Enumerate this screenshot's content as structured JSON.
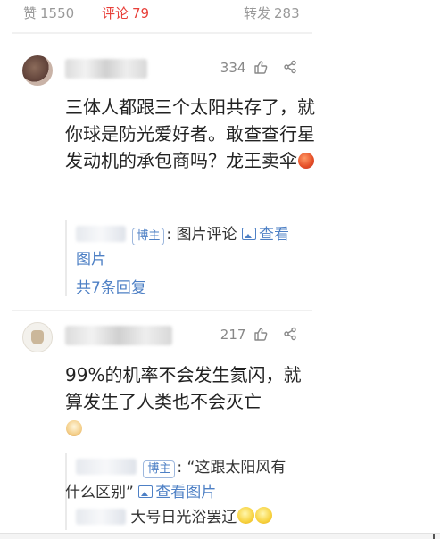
{
  "tabs": {
    "like": {
      "label": "赞",
      "count": "1550"
    },
    "comment": {
      "label": "评论",
      "count": "79"
    },
    "repost": {
      "label": "转发",
      "count": "283"
    }
  },
  "comments": [
    {
      "likes": "334",
      "text": "三体人都跟三个太阳共存了，就你球是防光爱好者。敢查查行星发动机的承包商吗？龙王卖伞",
      "emoji": "red-face-emoji",
      "reply": {
        "badge": "博主",
        "text_before": ": 图片评论",
        "link": "查看",
        "text_after": "图片"
      },
      "more_replies": "共7条回复"
    },
    {
      "likes": "217",
      "text": "99%的机率不会发生氦闪，就算发生了人类也不会灭亡",
      "emoji": "dog-emoji",
      "reply": {
        "badge": "博主",
        "text_line1": ": “这跟太阳风有",
        "text_line2": "什么区别”",
        "link": "查看图片",
        "second_reply": "大号日光浴罢辽"
      }
    }
  ]
}
